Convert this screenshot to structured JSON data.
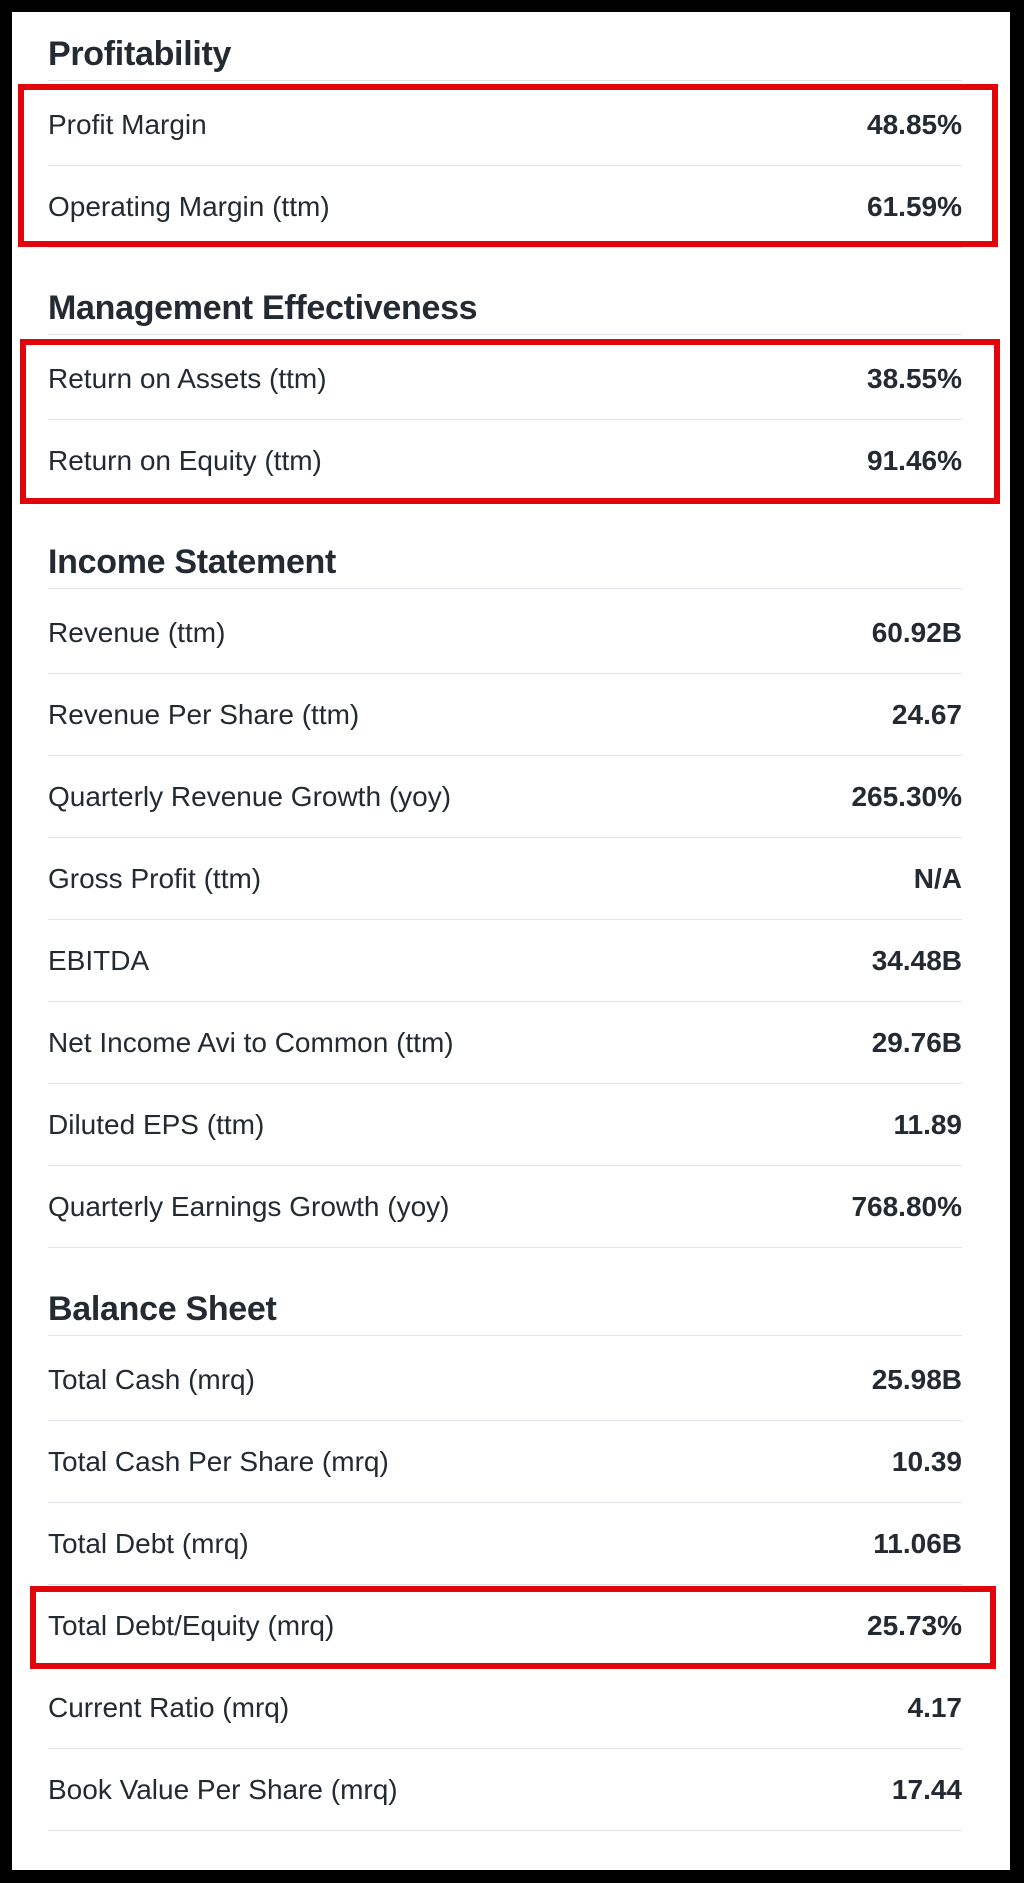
{
  "highlight_color": "#e0060c",
  "sections": [
    {
      "title": "Profitability",
      "rows": [
        {
          "label": "Profit Margin",
          "value": "48.85%"
        },
        {
          "label": "Operating Margin (ttm)",
          "value": "61.59%"
        }
      ]
    },
    {
      "title": "Management Effectiveness",
      "rows": [
        {
          "label": "Return on Assets (ttm)",
          "value": "38.55%"
        },
        {
          "label": "Return on Equity (ttm)",
          "value": "91.46%"
        }
      ]
    },
    {
      "title": "Income Statement",
      "rows": [
        {
          "label": "Revenue (ttm)",
          "value": "60.92B"
        },
        {
          "label": "Revenue Per Share (ttm)",
          "value": "24.67"
        },
        {
          "label": "Quarterly Revenue Growth (yoy)",
          "value": "265.30%"
        },
        {
          "label": "Gross Profit (ttm)",
          "value": "N/A"
        },
        {
          "label": "EBITDA",
          "value": "34.48B"
        },
        {
          "label": "Net Income Avi to Common (ttm)",
          "value": "29.76B"
        },
        {
          "label": "Diluted EPS (ttm)",
          "value": "11.89"
        },
        {
          "label": "Quarterly Earnings Growth (yoy)",
          "value": "768.80%"
        }
      ]
    },
    {
      "title": "Balance Sheet",
      "rows": [
        {
          "label": "Total Cash (mrq)",
          "value": "25.98B"
        },
        {
          "label": "Total Cash Per Share (mrq)",
          "value": "10.39"
        },
        {
          "label": "Total Debt (mrq)",
          "value": "11.06B"
        },
        {
          "label": "Total Debt/Equity (mrq)",
          "value": "25.73%"
        },
        {
          "label": "Current Ratio (mrq)",
          "value": "4.17"
        },
        {
          "label": "Book Value Per Share (mrq)",
          "value": "17.44"
        }
      ]
    }
  ]
}
